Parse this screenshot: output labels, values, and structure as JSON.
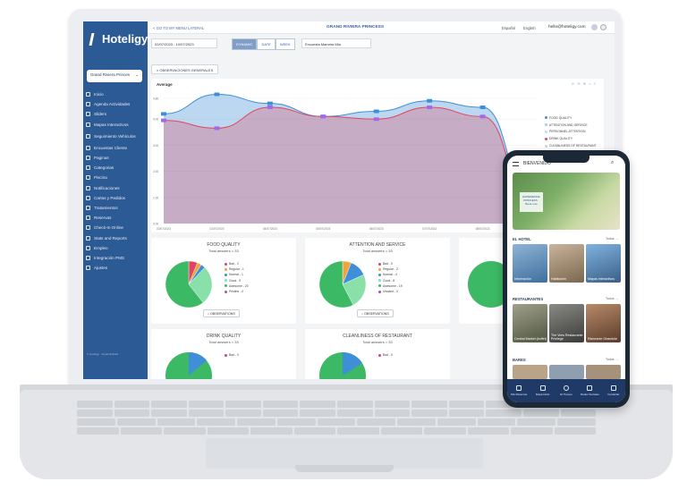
{
  "sidebar": {
    "logo": "Hoteligy",
    "hotel_select": "Grand Riviera Princes",
    "items": [
      {
        "label": "Inicio"
      },
      {
        "label": "Agenda Actividades"
      },
      {
        "label": "Sliders"
      },
      {
        "label": "Mapas Interactivos"
      },
      {
        "label": "Seguimiento Vehículos"
      },
      {
        "label": "Encuestas Cliente"
      },
      {
        "label": "Paginas"
      },
      {
        "label": "Categorias"
      },
      {
        "label": "Piscina"
      },
      {
        "label": "Notificaciones"
      },
      {
        "label": "Cartas y Pedidos"
      },
      {
        "label": "Tratamientos"
      },
      {
        "label": "Reservas"
      },
      {
        "label": "Check-In Online"
      },
      {
        "label": "Stats and Reports"
      },
      {
        "label": "Empleo"
      },
      {
        "label": "Integración PMS"
      },
      {
        "label": "Ajustes"
      }
    ],
    "footer": "© Hoteligy · Sostenibilidad"
  },
  "topbar": {
    "back_link": "< GO TO MY MENU LATERAL",
    "title": "GRAND RIVIERA PRINCESS",
    "lang1": "Español",
    "lang2": "English",
    "email": "hello@hoteligy.com"
  },
  "filters": {
    "date_range": "02/07/2023 - 10/07/2023",
    "segments": [
      "DYNAMIC",
      "DATE",
      "WEEK"
    ],
    "survey": "Encuesta Mamma Mia"
  },
  "observations_button": "OBSERVACIONES GENERALES",
  "chart": {
    "title": "Average",
    "tools": "⊙ ⊖ ⊕ ⌂ ≡"
  },
  "chart_data": {
    "type": "area",
    "x": [
      "02/07/2023",
      "03/07/2023",
      "04/07/2023",
      "05/07/2023",
      "06/07/2023",
      "07/07/2023",
      "08/07/2023",
      "09/07/2023"
    ],
    "yticks": [
      "0.00",
      "1.00",
      "2.00",
      "3.00",
      "4.00",
      "4.80"
    ],
    "ylim": [
      0,
      5
    ],
    "series": [
      {
        "name": "FOOD QUALITY",
        "color": "#3e8fd8",
        "values": [
          4.2,
          4.95,
          4.6,
          4.1,
          4.3,
          4.7,
          4.45,
          0.4
        ]
      },
      {
        "name": "ATTENTION AND SERVICE",
        "color": "#a8c8e8",
        "values": [
          null,
          null,
          null,
          null,
          null,
          null,
          null,
          null
        ]
      },
      {
        "name": "PERSONNEL ATTENTION",
        "color": "#c9d6e6",
        "values": [
          null,
          null,
          null,
          null,
          null,
          null,
          null,
          null
        ]
      },
      {
        "name": "DRINK QUALITY",
        "color": "#e2445f",
        "values": [
          3.95,
          3.65,
          4.45,
          4.1,
          4.0,
          4.45,
          4.1,
          0.3
        ]
      },
      {
        "name": "CLEANLINESS OF RESTAURANT",
        "color": "#c9d6e6",
        "values": [
          null,
          null,
          null,
          null,
          null,
          null,
          null,
          null
        ]
      }
    ],
    "grid": true,
    "legend": "right"
  },
  "pies": [
    {
      "title": "FOOD QUALITY",
      "total": "Total answers = 33",
      "legend": [
        {
          "label": "Bad - 2",
          "color": "#e2445f",
          "value": 2
        },
        {
          "label": "Regular - 1",
          "color": "#f1a33c",
          "value": 1
        },
        {
          "label": "Normal - 1",
          "color": "#3e8fd8",
          "value": 1
        },
        {
          "label": "Good - 9",
          "color": "#89e0a8",
          "value": 9
        },
        {
          "label": "Awesome - 20",
          "color": "#3cb964",
          "value": 20
        },
        {
          "label": "Pristine - 0",
          "color": "#9b59b6",
          "value": 0
        }
      ],
      "obs": "OBSERVATIONS"
    },
    {
      "title": "ATTENTION AND SERVICE",
      "total": "Total answers = 33",
      "legend": [
        {
          "label": "Bad - 0",
          "color": "#e2445f",
          "value": 0
        },
        {
          "label": "Regular - 2",
          "color": "#f1a33c",
          "value": 2
        },
        {
          "label": "Normal - 4",
          "color": "#3e8fd8",
          "value": 4
        },
        {
          "label": "Good - 8",
          "color": "#89e0a8",
          "value": 8
        },
        {
          "label": "Awesome - 19",
          "color": "#3cb964",
          "value": 19
        },
        {
          "label": "Unrated - 0",
          "color": "#9b59b6",
          "value": 0
        }
      ],
      "obs": "OBSERVATIONS"
    },
    {
      "title": "DRINK QUALITY",
      "total": "Total answers = 33",
      "legend": [
        {
          "label": "Bad - 0",
          "color": "#e2445f",
          "value": 0
        }
      ],
      "obs": ""
    },
    {
      "title": "CLEANLINESS OF RESTAURANT",
      "total": "Total answers = 33",
      "legend": [
        {
          "label": "Bad - 0",
          "color": "#e2445f",
          "value": 0
        }
      ],
      "obs": ""
    }
  ],
  "phone": {
    "welcome": "BIENVENIDO",
    "hero_badge": "EXPERIENCE PRINCESS · Book now",
    "section_hotel": "EL HOTEL",
    "section_rest": "RESTAURANTES",
    "section_bars": "BARES",
    "todos": "Todos →",
    "hotel_tiles": [
      "Información",
      "Habitación",
      "Mapas interactivos"
    ],
    "rest_tiles": [
      "Central Market (buffet)",
      "The View Restaurante Privilege",
      "Ristorante Girandole"
    ],
    "tabs": [
      "Mis Reservas",
      "Mapa Hotel",
      "El Tiempo",
      "Redes Sociales",
      "Contactar"
    ]
  }
}
